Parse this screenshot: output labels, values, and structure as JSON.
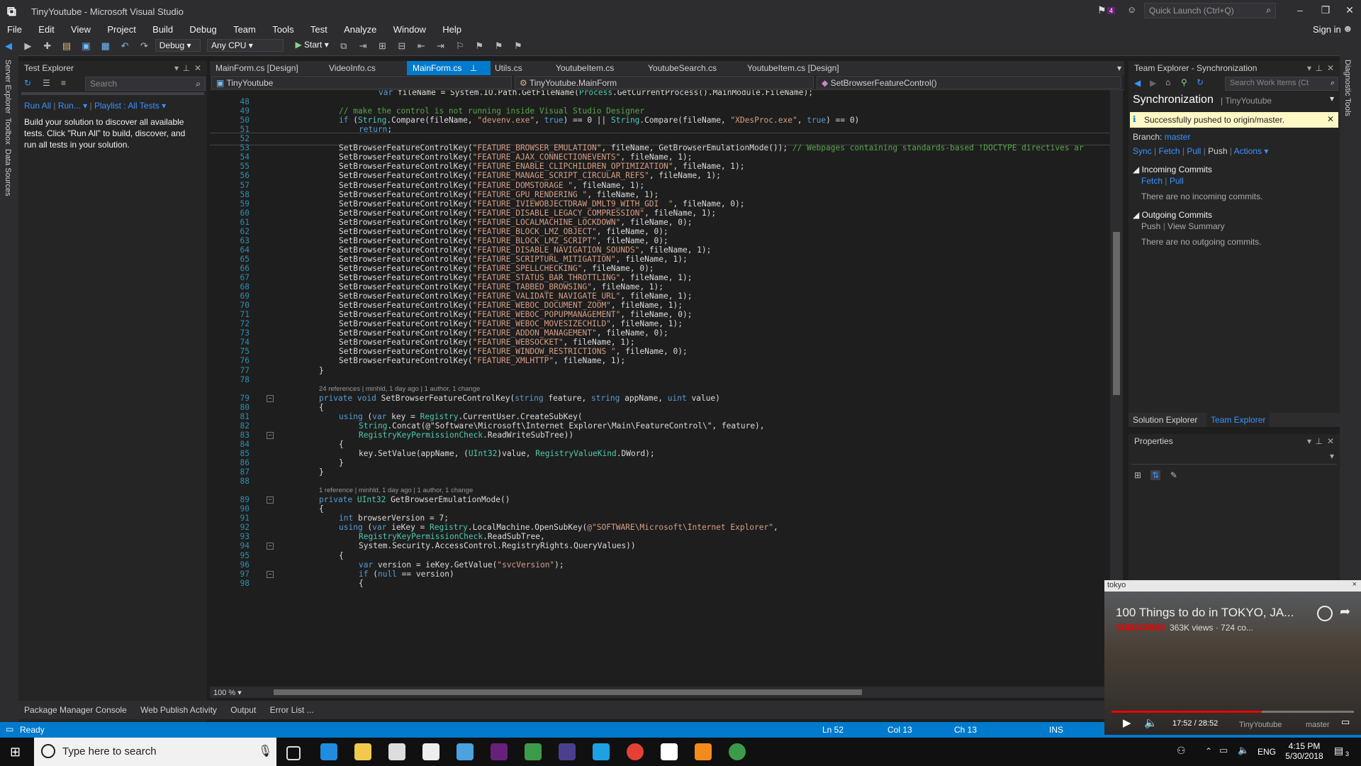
{
  "window": {
    "title": "TinyYoutube - Microsoft Visual Studio",
    "notification_count": "4",
    "quick_launch_placeholder": "Quick Launch (Ctrl+Q)",
    "sign_in": "Sign in"
  },
  "menu": [
    "File",
    "Edit",
    "View",
    "Project",
    "Build",
    "Debug",
    "Team",
    "Tools",
    "Test",
    "Analyze",
    "Window",
    "Help"
  ],
  "toolbar": {
    "configuration": "Debug",
    "platform": "Any CPU",
    "start_label": "Start"
  },
  "left_strip": [
    "Server Explorer",
    "Toolbox",
    "Data Sources"
  ],
  "test_explorer": {
    "title": "Test Explorer",
    "search_placeholder": "Search",
    "run_all": "Run All",
    "run": "Run...",
    "playlist": "Playlist : All Tests",
    "message": "Build your solution to discover all available tests. Click \"Run All\" to build, discover, and run all tests in your solution."
  },
  "editor": {
    "tabs": [
      {
        "label": "MainForm.cs [Design]",
        "active": false
      },
      {
        "label": "VideoInfo.cs",
        "active": false
      },
      {
        "label": "MainForm.cs",
        "active": true
      },
      {
        "label": "Utils.cs",
        "active": false
      },
      {
        "label": "YoutubeItem.cs",
        "active": false
      },
      {
        "label": "YoutubeSearch.cs",
        "active": false
      },
      {
        "label": "YoutubeItem.cs [Design]",
        "active": false
      }
    ],
    "nav_project": "TinyYoutube",
    "nav_class": "TinyYoutube.MainForm",
    "nav_member": "SetBrowserFeatureControl()",
    "zoom": "100 %",
    "lines": [
      {
        "n": "",
        "t": "var fileName = System.IO.Path.GetFileName(Process.GetCurrentProcess().MainModule.FileName);",
        "i": 5
      },
      {
        "n": "48",
        "t": "",
        "i": 0
      },
      {
        "n": "49",
        "t": "// make the control is not running inside Visual Studio Designer",
        "i": 3,
        "c": "cmt"
      },
      {
        "n": "50",
        "t": "if (String.Compare(fileName, \"devenv.exe\", true) == 0 || String.Compare(fileName, \"XDesProc.exe\", true) == 0)",
        "i": 3
      },
      {
        "n": "51",
        "t": "return;",
        "i": 4
      },
      {
        "n": "52",
        "t": "",
        "i": 3
      },
      {
        "n": "53",
        "t": "SetBrowserFeatureControlKey(\"FEATURE_BROWSER_EMULATION\", fileName, GetBrowserEmulationMode()); // Webpages containing standards-based !DOCTYPE directives ar",
        "i": 3
      },
      {
        "n": "54",
        "t": "SetBrowserFeatureControlKey(\"FEATURE_AJAX_CONNECTIONEVENTS\", fileName, 1);",
        "i": 3
      },
      {
        "n": "55",
        "t": "SetBrowserFeatureControlKey(\"FEATURE_ENABLE_CLIPCHILDREN_OPTIMIZATION\", fileName, 1);",
        "i": 3
      },
      {
        "n": "56",
        "t": "SetBrowserFeatureControlKey(\"FEATURE_MANAGE_SCRIPT_CIRCULAR_REFS\", fileName, 1);",
        "i": 3
      },
      {
        "n": "57",
        "t": "SetBrowserFeatureControlKey(\"FEATURE_DOMSTORAGE \", fileName, 1);",
        "i": 3
      },
      {
        "n": "58",
        "t": "SetBrowserFeatureControlKey(\"FEATURE_GPU_RENDERING \", fileName, 1);",
        "i": 3
      },
      {
        "n": "59",
        "t": "SetBrowserFeatureControlKey(\"FEATURE_IVIEWOBJECTDRAW_DMLT9_WITH_GDI  \", fileName, 0);",
        "i": 3
      },
      {
        "n": "60",
        "t": "SetBrowserFeatureControlKey(\"FEATURE_DISABLE_LEGACY_COMPRESSION\", fileName, 1);",
        "i": 3
      },
      {
        "n": "61",
        "t": "SetBrowserFeatureControlKey(\"FEATURE_LOCALMACHINE_LOCKDOWN\", fileName, 0);",
        "i": 3
      },
      {
        "n": "62",
        "t": "SetBrowserFeatureControlKey(\"FEATURE_BLOCK_LMZ_OBJECT\", fileName, 0);",
        "i": 3
      },
      {
        "n": "63",
        "t": "SetBrowserFeatureControlKey(\"FEATURE_BLOCK_LMZ_SCRIPT\", fileName, 0);",
        "i": 3
      },
      {
        "n": "64",
        "t": "SetBrowserFeatureControlKey(\"FEATURE_DISABLE_NAVIGATION_SOUNDS\", fileName, 1);",
        "i": 3
      },
      {
        "n": "65",
        "t": "SetBrowserFeatureControlKey(\"FEATURE_SCRIPTURL_MITIGATION\", fileName, 1);",
        "i": 3
      },
      {
        "n": "66",
        "t": "SetBrowserFeatureControlKey(\"FEATURE_SPELLCHECKING\", fileName, 0);",
        "i": 3
      },
      {
        "n": "67",
        "t": "SetBrowserFeatureControlKey(\"FEATURE_STATUS_BAR_THROTTLING\", fileName, 1);",
        "i": 3
      },
      {
        "n": "68",
        "t": "SetBrowserFeatureControlKey(\"FEATURE_TABBED_BROWSING\", fileName, 1);",
        "i": 3
      },
      {
        "n": "69",
        "t": "SetBrowserFeatureControlKey(\"FEATURE_VALIDATE_NAVIGATE_URL\", fileName, 1);",
        "i": 3
      },
      {
        "n": "70",
        "t": "SetBrowserFeatureControlKey(\"FEATURE_WEBOC_DOCUMENT_ZOOM\", fileName, 1);",
        "i": 3
      },
      {
        "n": "71",
        "t": "SetBrowserFeatureControlKey(\"FEATURE_WEBOC_POPUPMANAGEMENT\", fileName, 0);",
        "i": 3
      },
      {
        "n": "72",
        "t": "SetBrowserFeatureControlKey(\"FEATURE_WEBOC_MOVESIZECHILD\", fileName, 1);",
        "i": 3
      },
      {
        "n": "73",
        "t": "SetBrowserFeatureControlKey(\"FEATURE_ADDON_MANAGEMENT\", fileName, 0);",
        "i": 3
      },
      {
        "n": "74",
        "t": "SetBrowserFeatureControlKey(\"FEATURE_WEBSOCKET\", fileName, 1);",
        "i": 3
      },
      {
        "n": "75",
        "t": "SetBrowserFeatureControlKey(\"FEATURE_WINDOW_RESTRICTIONS \", fileName, 0);",
        "i": 3
      },
      {
        "n": "76",
        "t": "SetBrowserFeatureControlKey(\"FEATURE_XMLHTTP\", fileName, 1);",
        "i": 3
      },
      {
        "n": "77",
        "t": "}",
        "i": 2
      },
      {
        "n": "78",
        "t": "",
        "i": 0
      },
      {
        "n": "",
        "t": "24 references | minhld, 1 day ago | 1 author, 1 change",
        "i": 2,
        "lens": true
      },
      {
        "n": "79",
        "t": "private void SetBrowserFeatureControlKey(string feature, string appName, uint value)",
        "i": 2,
        "fold": true
      },
      {
        "n": "80",
        "t": "{",
        "i": 2
      },
      {
        "n": "81",
        "t": "using (var key = Registry.CurrentUser.CreateSubKey(",
        "i": 3
      },
      {
        "n": "82",
        "t": "String.Concat(@\"Software\\Microsoft\\Internet Explorer\\Main\\FeatureControl\\\", feature),",
        "i": 4
      },
      {
        "n": "83",
        "t": "RegistryKeyPermissionCheck.ReadWriteSubTree))",
        "i": 4,
        "fold": true
      },
      {
        "n": "84",
        "t": "{",
        "i": 3
      },
      {
        "n": "85",
        "t": "key.SetValue(appName, (UInt32)value, RegistryValueKind.DWord);",
        "i": 4
      },
      {
        "n": "86",
        "t": "}",
        "i": 3
      },
      {
        "n": "87",
        "t": "}",
        "i": 2
      },
      {
        "n": "88",
        "t": "",
        "i": 0
      },
      {
        "n": "",
        "t": "1 reference | minhld, 1 day ago | 1 author, 1 change",
        "i": 2,
        "lens": true
      },
      {
        "n": "89",
        "t": "private UInt32 GetBrowserEmulationMode()",
        "i": 2,
        "fold": true
      },
      {
        "n": "90",
        "t": "{",
        "i": 2
      },
      {
        "n": "91",
        "t": "int browserVersion = 7;",
        "i": 3
      },
      {
        "n": "92",
        "t": "using (var ieKey = Registry.LocalMachine.OpenSubKey(@\"SOFTWARE\\Microsoft\\Internet Explorer\",",
        "i": 3
      },
      {
        "n": "93",
        "t": "RegistryKeyPermissionCheck.ReadSubTree,",
        "i": 4
      },
      {
        "n": "94",
        "t": "System.Security.AccessControl.RegistryRights.QueryValues))",
        "i": 4,
        "fold": true
      },
      {
        "n": "95",
        "t": "{",
        "i": 3
      },
      {
        "n": "96",
        "t": "var version = ieKey.GetValue(\"svcVersion\");",
        "i": 4
      },
      {
        "n": "97",
        "t": "if (null == version)",
        "i": 4,
        "fold": true
      },
      {
        "n": "98",
        "t": "{",
        "i": 4
      }
    ]
  },
  "bottom_tabs": [
    "Package Manager Console",
    "Web Publish Activity",
    "Output",
    "Error List ..."
  ],
  "status": {
    "ready": "Ready",
    "ln": "Ln 52",
    "col": "Col 13",
    "ch": "Ch 13",
    "ins": "INS"
  },
  "team_explorer": {
    "title": "Team Explorer - Synchronization",
    "search_placeholder": "Search Work Items (Ct",
    "heading": "Synchronization",
    "repo": "TinyYoutube",
    "notice": "Successfully pushed to origin/master.",
    "branch_label": "Branch:",
    "branch": "master",
    "actions": [
      "Sync",
      "Fetch",
      "Pull",
      "Push",
      "Actions"
    ],
    "incoming_title": "Incoming Commits",
    "incoming_links": [
      "Fetch",
      "Pull"
    ],
    "incoming_empty": "There are no incoming commits.",
    "outgoing_title": "Outgoing Commits",
    "outgoing_links": [
      "Push",
      "View Summary"
    ],
    "outgoing_empty": "There are no outgoing commits.",
    "tab_solution": "Solution Explorer",
    "tab_team": "Team Explorer"
  },
  "properties": {
    "title": "Properties"
  },
  "right_strip": [
    "Diagnostic Tools"
  ],
  "video": {
    "window_title": "tokyo",
    "title": "100 Things to do in TOKYO, JA...",
    "subscribe": "SUBSCRIBE",
    "views": "363K views · 724 co...",
    "time": "17:52 / 28:52",
    "progress": 0.62,
    "repo": "TinyYoutube",
    "branch": "master"
  },
  "taskbar": {
    "search_placeholder": "Type here to search",
    "lang": "ENG",
    "time": "4:15 PM",
    "date": "5/30/2018",
    "notifications": "3"
  },
  "colors": {
    "accent": "#007acc",
    "background": "#1e1e1e",
    "chrome": "#2d2d30"
  }
}
